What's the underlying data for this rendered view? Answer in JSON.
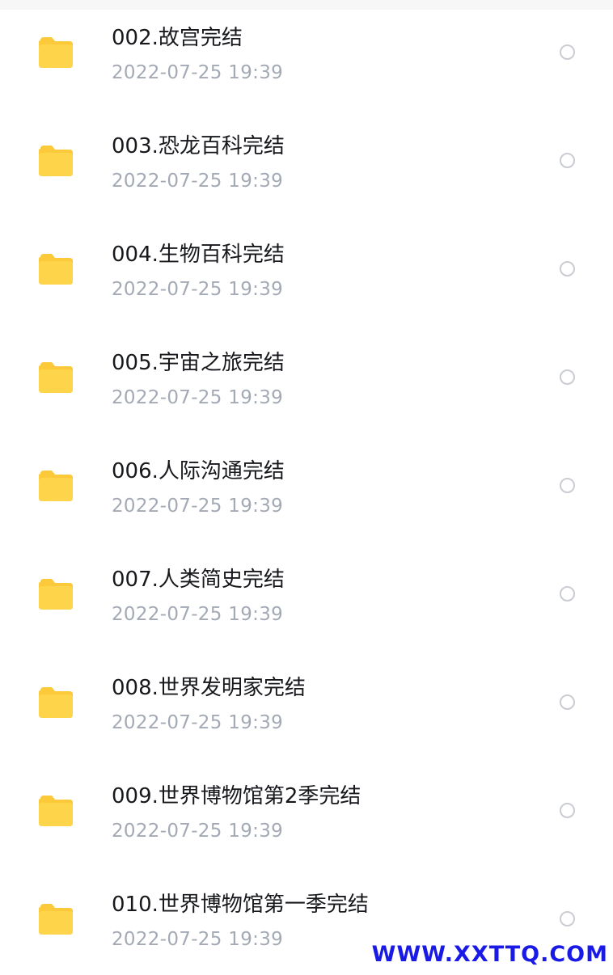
{
  "files": [
    {
      "name": "002.故宫完结",
      "date": "2022-07-25  19:39",
      "icon": "folder-icon"
    },
    {
      "name": "003.恐龙百科完结",
      "date": "2022-07-25  19:39",
      "icon": "folder-icon"
    },
    {
      "name": "004.生物百科完结",
      "date": "2022-07-25  19:39",
      "icon": "folder-icon"
    },
    {
      "name": "005.宇宙之旅完结",
      "date": "2022-07-25  19:39",
      "icon": "folder-icon"
    },
    {
      "name": "006.人际沟通完结",
      "date": "2022-07-25  19:39",
      "icon": "folder-icon"
    },
    {
      "name": "007.人类简史完结",
      "date": "2022-07-25  19:39",
      "icon": "folder-icon"
    },
    {
      "name": "008.世界发明家完结",
      "date": "2022-07-25  19:39",
      "icon": "folder-icon"
    },
    {
      "name": "009.世界博物馆第2季完结",
      "date": "2022-07-25  19:39",
      "icon": "folder-icon"
    },
    {
      "name": "010.世界博物馆第一季完结",
      "date": "2022-07-25  19:39",
      "icon": "folder-icon"
    }
  ],
  "watermark": "WWW.XXTTQ.COM",
  "colors": {
    "folder": "#fed54a",
    "folder_tab": "#fcc93a",
    "name_text": "#16181c",
    "date_text": "#a4aab5",
    "radio_border": "#c9ccd2",
    "watermark": "#1a1ae6"
  }
}
